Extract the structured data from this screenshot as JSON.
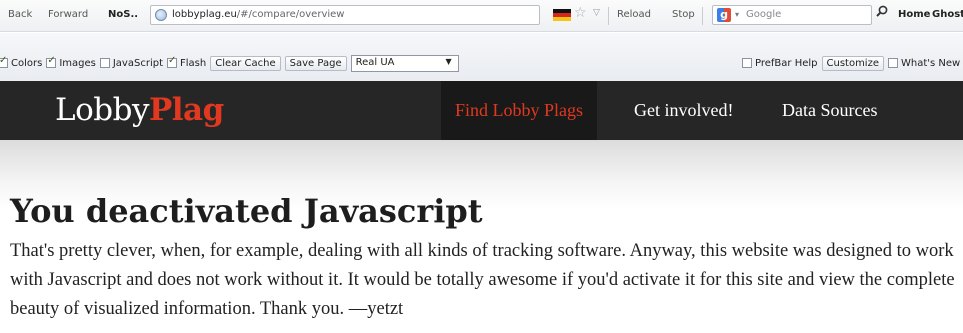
{
  "browser": {
    "back_label": "Back",
    "forward_label": "Forward",
    "noscript_label": "NoS..",
    "url_host": "lobbyplag.eu",
    "url_path": "/#/compare/overview",
    "reload_label": "Reload",
    "stop_label": "Stop",
    "search_placeholder": "Google",
    "home_label": "Home",
    "ghostery_label": "Ghostery"
  },
  "prefbar": {
    "toggles": [
      {
        "label": "Colors",
        "checked": true
      },
      {
        "label": "Images",
        "checked": true
      },
      {
        "label": "JavaScript",
        "checked": false
      },
      {
        "label": "Flash",
        "checked": true
      }
    ],
    "clear_cache_label": "Clear Cache",
    "save_page_label": "Save Page",
    "ua_select_value": "Real UA",
    "prefbar_help_label": "PrefBar Help",
    "customize_label": "Customize",
    "whats_new_label": "What's New"
  },
  "site": {
    "logo_part1": "Lobby",
    "logo_part2": "Plag",
    "nav": [
      "Find Lobby Plags",
      "Get involved!",
      "Data Sources"
    ]
  },
  "main": {
    "heading": "You deactivated Javascript",
    "message": "That's pretty clever, when, for example, dealing with all kinds of tracking software. Anyway, this website was designed to work with Javascript and does not work without it. It would be totally awesome if you'd activate it for this site and view the complete beauty of visualized information. Thank you. —yetzt"
  },
  "colors": {
    "accent_red": "#e0391f",
    "header_bg": "#262626"
  }
}
